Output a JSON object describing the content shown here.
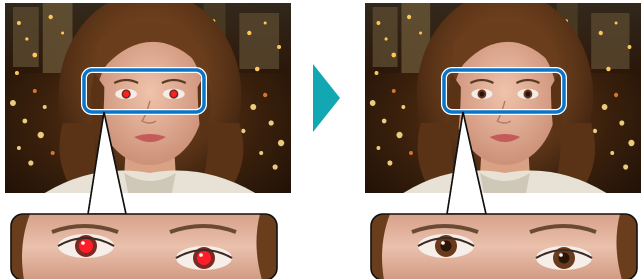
{
  "panels": [
    {
      "id": "before",
      "state": "red-eye",
      "iris_color": "#c4001a",
      "pupil_color": "#ff1d2a"
    },
    {
      "id": "after",
      "state": "corrected",
      "iris_color": "#6a3a1e",
      "pupil_color": "#2b1408"
    }
  ],
  "colors": {
    "highlight_frame": "#0a74c9",
    "arrow": "#13a6b3",
    "background_night": "#2a1608",
    "city_lights": "#ffbd4a",
    "hair": "#6a3d1c",
    "skin": "#e6b39a"
  },
  "icons": {
    "transition_arrow": "right-triangle-arrow-icon"
  }
}
